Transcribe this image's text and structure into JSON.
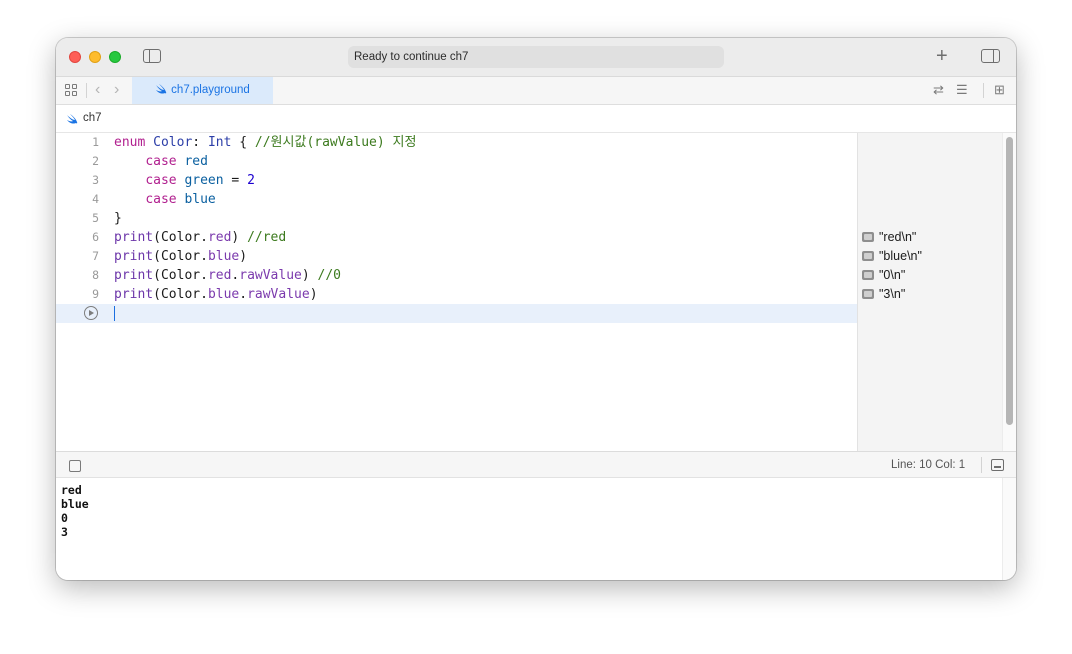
{
  "window": {
    "status_text": "Ready to continue ch7"
  },
  "tabbar": {
    "active_tab_label": "ch7.playground"
  },
  "jumpbar": {
    "label": "ch7"
  },
  "editor": {
    "line_numbers": [
      "1",
      "2",
      "3",
      "4",
      "5",
      "6",
      "7",
      "8",
      "9"
    ],
    "lines": [
      "enum Color: Int { //원시값(rawValue) 지정",
      "    case red",
      "    case green = 2",
      "    case blue",
      "}",
      "print(Color.red) //red",
      "print(Color.blue)",
      "print(Color.red.rawValue) //0",
      "print(Color.blue.rawValue)"
    ]
  },
  "results": [
    {
      "line": 6,
      "value": "\"red\\n\""
    },
    {
      "line": 7,
      "value": "\"blue\\n\""
    },
    {
      "line": 8,
      "value": "\"0\\n\""
    },
    {
      "line": 9,
      "value": "\"3\\n\""
    }
  ],
  "debug_bar": {
    "position": "Line: 10  Col: 1"
  },
  "console": {
    "output": [
      "red",
      "blue",
      "0",
      "3"
    ]
  },
  "icons": {
    "sidebar": "sidebar-icon",
    "add": "plus-icon",
    "inspector": "inspector-icon",
    "grid": "grid-icon",
    "back": "chevron-left-icon",
    "forward": "chevron-right-icon",
    "swift": "swift-icon",
    "run": "play-circle-icon"
  },
  "colors": {
    "keyword": "#b1208f",
    "type": "#2d3fa8",
    "function": "#6c36a9",
    "comment": "#3c7a1e",
    "case_name": "#0b60a0",
    "number": "#1c00cf",
    "tab_active": "#1b74e4"
  }
}
